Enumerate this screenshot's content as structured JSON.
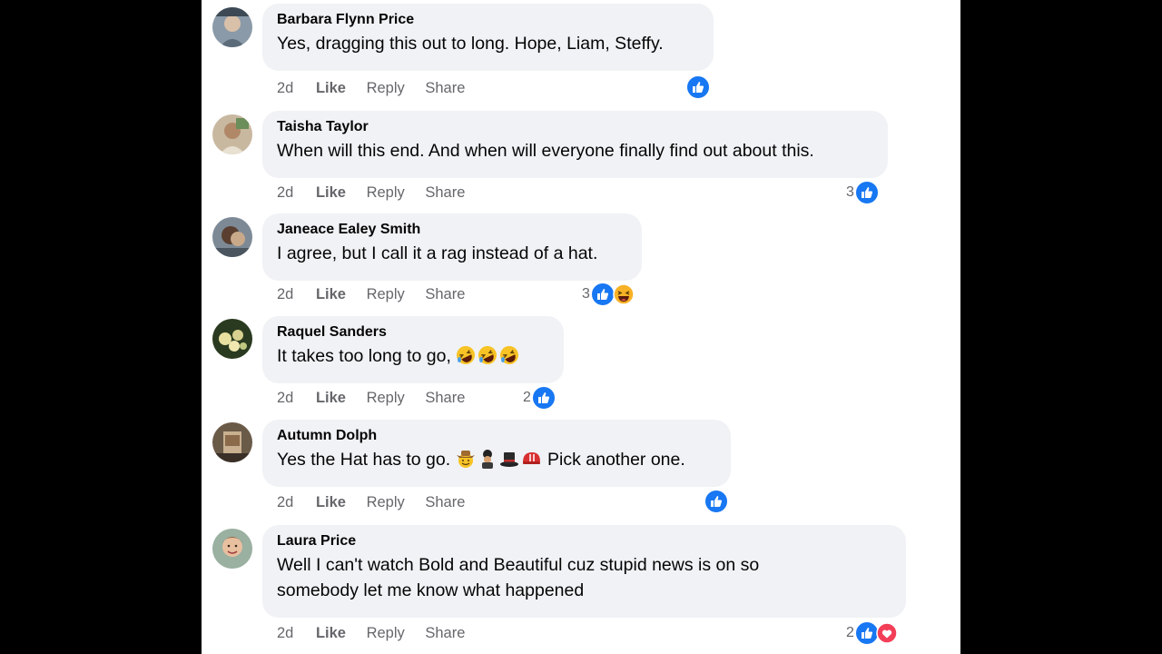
{
  "comments": [
    {
      "author": "Barbara Flynn Price",
      "text": "Yes, dragging this out to long. Hope, Liam, Steffy.",
      "time": "2d",
      "like": "Like",
      "reply": "Reply",
      "share": "Share",
      "reaction_count": "",
      "reactions": [
        "like"
      ]
    },
    {
      "author": "Taisha Taylor",
      "text": "When will this end. And when will everyone finally find out about this.",
      "time": "2d",
      "like": "Like",
      "reply": "Reply",
      "share": "Share",
      "reaction_count": "3",
      "reactions": [
        "like"
      ]
    },
    {
      "author": "Janeace Ealey Smith",
      "text": "I agree, but I call it a rag instead of a hat.",
      "time": "2d",
      "like": "Like",
      "reply": "Reply",
      "share": "Share",
      "reaction_count": "3",
      "reactions": [
        "like",
        "haha"
      ]
    },
    {
      "author": "Raquel Sanders",
      "text": "It takes too long to go,",
      "text_emojis": [
        "rofl-emoji",
        "rofl-emoji",
        "rofl-emoji"
      ],
      "time": "2d",
      "like": "Like",
      "reply": "Reply",
      "share": "Share",
      "reaction_count": "2",
      "reactions": [
        "like"
      ]
    },
    {
      "author": "Autumn Dolph",
      "text": "Yes the Hat has to go.",
      "text_emojis": [
        "cowboy-hat-face-emoji",
        "guard-emoji",
        "top-hat-emoji",
        "helmet-emoji"
      ],
      "text_after": "Pick another one.",
      "time": "2d",
      "like": "Like",
      "reply": "Reply",
      "share": "Share",
      "reaction_count": "",
      "reactions": [
        "like"
      ]
    },
    {
      "author": "Laura Price",
      "text": "Well I can't watch Bold and Beautiful cuz stupid news is on so somebody let me know what happened",
      "time": "2d",
      "like": "Like",
      "reply": "Reply",
      "share": "Share",
      "reaction_count": "2",
      "reactions": [
        "like",
        "love"
      ]
    }
  ],
  "colors": {
    "like_blue": "#1877f2",
    "love_red": "#f33e58",
    "haha_yellow": "#f7b125",
    "bubble_bg": "#f0f2f5",
    "meta_gray": "#65676b"
  }
}
